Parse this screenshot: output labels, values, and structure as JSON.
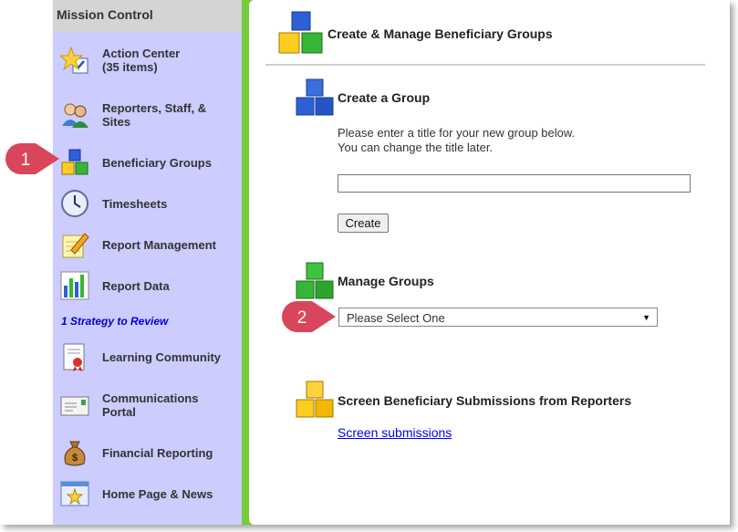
{
  "sidebar": {
    "header": "Mission Control",
    "items": [
      {
        "label": "Action Center\n(35 items)",
        "icon": "star-checklist-icon"
      },
      {
        "label": "Reporters, Staff, &\nSites",
        "icon": "people-icon"
      },
      {
        "label": "Beneficiary Groups",
        "icon": "blocks-icon"
      },
      {
        "label": "Timesheets",
        "icon": "clock-icon"
      },
      {
        "label": "Report Management",
        "icon": "pencil-notepad-icon"
      },
      {
        "label": "Report Data",
        "icon": "bar-chart-icon"
      },
      {
        "label": "Learning Community",
        "icon": "certificate-icon"
      },
      {
        "label": "Communications\nPortal",
        "icon": "envelope-icon"
      },
      {
        "label": "Financial Reporting",
        "icon": "money-bag-icon"
      },
      {
        "label": "Home Page & News",
        "icon": "home-star-icon"
      }
    ],
    "strategy_link": "1 Strategy to Review"
  },
  "main": {
    "title": "Create & Manage Beneficiary Groups",
    "create_section": {
      "title": "Create a Group",
      "help_line1": "Please enter a title for your new group below.",
      "help_line2": "You can change the title later.",
      "input_value": "",
      "button": "Create"
    },
    "manage_section": {
      "title": "Manage Groups",
      "select_value": "Please Select One"
    },
    "screen_section": {
      "title": "Screen Beneficiary Submissions from Reporters",
      "link": "Screen submissions"
    }
  },
  "callouts": [
    "1",
    "2"
  ],
  "colors": {
    "sidebar_bg": "#ccccff",
    "accent_green": "#76cc3a",
    "callout_red": "#d9455a",
    "link_blue": "#0000ee"
  }
}
